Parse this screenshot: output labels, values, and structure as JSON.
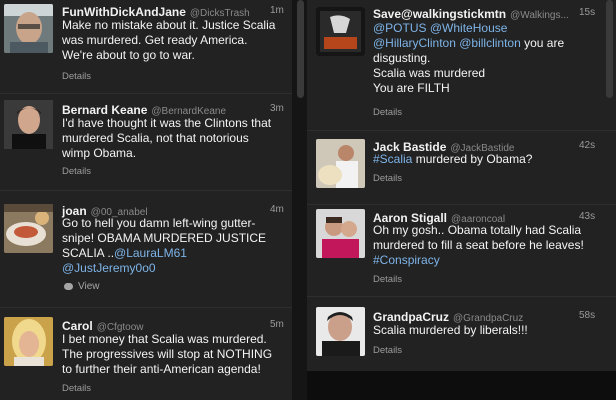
{
  "columns": {
    "left": [
      {
        "name": "FunWithDickAndJane",
        "handle": "@DicksTrash",
        "time": "1m",
        "lines": [
          "Make no mistake about it. Justice Scalia",
          "was murdered. Get ready America.",
          "We're about to go to war."
        ],
        "details": "Details"
      },
      {
        "name": "Bernard Keane",
        "handle": "@BernardKeane",
        "time": "3m",
        "lines": [
          "I'd have thought it was the Clintons that",
          "murdered Scalia, not that notorious",
          "wimp Obama."
        ],
        "details": "Details"
      },
      {
        "name": "joan",
        "handle": "@00_anabel",
        "time": "4m",
        "lines": [
          "Go to hell you damn left-wing gutter-",
          "snipe! OBAMA MURDERED JUSTICE",
          "SCALIA .."
        ],
        "mention1": "@LauraLM61",
        "mention2": "@JustJeremy0o0",
        "view": "View"
      },
      {
        "name": "Carol",
        "handle": "@Cfgtoow",
        "time": "5m",
        "lines": [
          "I bet money that Scalia was murdered.",
          "The progressives will stop at NOTHING",
          "to further their anti-American agenda!"
        ],
        "details": "Details"
      }
    ],
    "right": [
      {
        "name": "Save@walkingstickmtn",
        "handle": "@Walkings...",
        "time": "15s",
        "mention_potus": "@POTUS",
        "mention_whitehouse": "@WhiteHouse",
        "mention_hillary": "@HillaryClinton",
        "mention_bill": "@billclinton",
        "tail1": " you are",
        "tail2": "disgusting.",
        "line3": "Scalia was murdered",
        "line4": "You are FILTH",
        "details": "Details"
      },
      {
        "name": "Jack Bastide",
        "handle": "@JackBastide",
        "time": "42s",
        "hashtag": "#Scalia",
        "rest": " murdered by Obama?",
        "details": "Details"
      },
      {
        "name": "Aaron Stigall",
        "handle": "@aaroncoal",
        "time": "43s",
        "lines": [
          "Oh my gosh.. Obama totally had Scalia",
          "murdered to fill a seat before he leaves!"
        ],
        "hashtag": "#Conspiracy",
        "details": "Details"
      },
      {
        "name": "GrandpaCruz",
        "handle": "@GrandpaCruz",
        "time": "58s",
        "lines": [
          "Scalia murdered by liberals!!!"
        ],
        "details": "Details"
      }
    ]
  },
  "icons": {
    "reply_bubble": "speech-bubble-icon"
  },
  "colors": {
    "background": "#222222",
    "link": "#7eb4e8"
  }
}
